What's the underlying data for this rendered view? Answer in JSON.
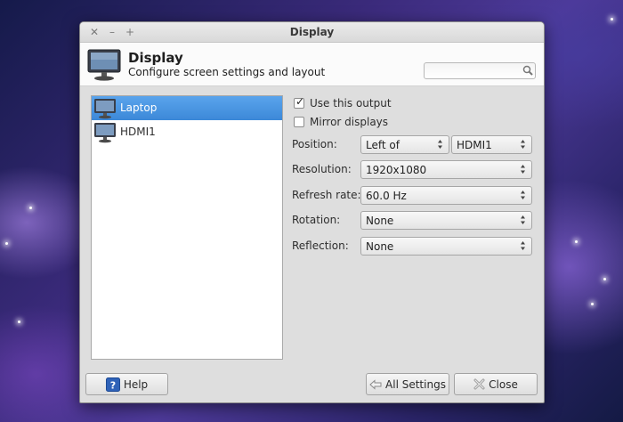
{
  "window": {
    "title": "Display"
  },
  "header": {
    "title": "Display",
    "subtitle": "Configure screen settings and layout",
    "search_value": "",
    "icon": "monitor-icon"
  },
  "outputs": [
    {
      "label": "Laptop",
      "selected": true
    },
    {
      "label": "HDMI1",
      "selected": false
    }
  ],
  "options": {
    "use_output": {
      "label": "Use this output",
      "checked": true
    },
    "mirror": {
      "label": "Mirror displays",
      "checked": false
    }
  },
  "fields": {
    "position": {
      "label": "Position:",
      "value": "Left of",
      "target": "HDMI1"
    },
    "resolution": {
      "label": "Resolution:",
      "value": "1920x1080"
    },
    "refresh": {
      "label": "Refresh rate:",
      "value": "60.0 Hz"
    },
    "rotation": {
      "label": "Rotation:",
      "value": "None"
    },
    "reflection": {
      "label": "Reflection:",
      "value": "None"
    }
  },
  "buttons": {
    "help": "Help",
    "all_settings": "All Settings",
    "close": "Close"
  },
  "colors": {
    "selection": "#3c88d8",
    "window_bg": "#dedede"
  }
}
